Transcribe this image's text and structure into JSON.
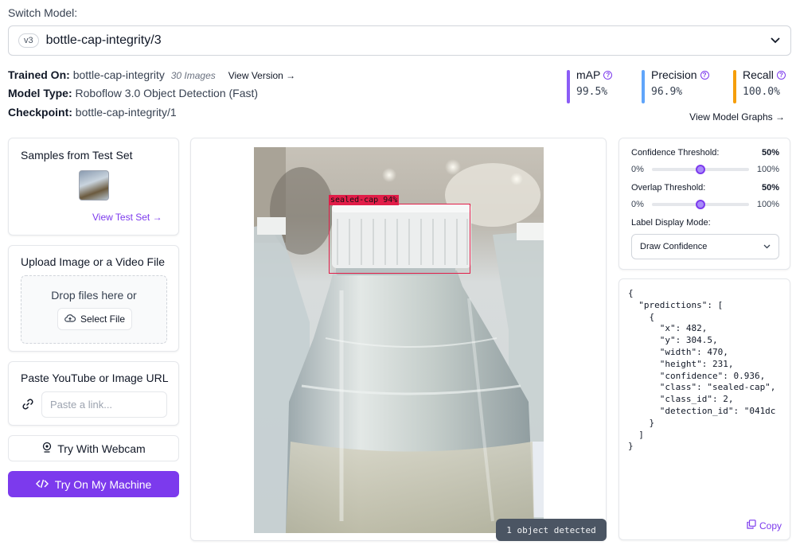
{
  "header": {
    "switch_label": "Switch Model:",
    "model_version_badge": "v3",
    "model_name": "bottle-cap-integrity/3",
    "chevron_icon": "chevron-down-icon"
  },
  "model_info": {
    "trained_on_label": "Trained On:",
    "trained_on_value": "bottle-cap-integrity",
    "image_count": "30 Images",
    "view_version": "View Version →",
    "model_type_label": "Model Type:",
    "model_type_value": "Roboflow 3.0 Object Detection (Fast)",
    "checkpoint_label": "Checkpoint:",
    "checkpoint_value": "bottle-cap-integrity/1"
  },
  "metrics": [
    {
      "label": "mAP",
      "value": "99.5%",
      "color": "#8b5cf6"
    },
    {
      "label": "Precision",
      "value": "96.9%",
      "color": "#60a5fa"
    },
    {
      "label": "Recall",
      "value": "100.0%",
      "color": "#f59e0b"
    }
  ],
  "view_model_graphs": "View Model Graphs →",
  "samples": {
    "title": "Samples from Test Set",
    "link": "View Test Set →"
  },
  "upload": {
    "title": "Upload Image or a Video File",
    "drop_text": "Drop files here or",
    "select_button": "Select File"
  },
  "url": {
    "title": "Paste YouTube or Image URL",
    "placeholder": "Paste a link..."
  },
  "webcam_button": "Try With Webcam",
  "machine_button": "Try On My Machine",
  "detection": {
    "label": "sealed-cap 94%",
    "status": "1 object detected"
  },
  "settings": {
    "confidence_label": "Confidence Threshold:",
    "confidence_value": "50%",
    "overlap_label": "Overlap Threshold:",
    "overlap_value": "50%",
    "min_label": "0%",
    "max_label": "100%",
    "confidence_level": 0.5,
    "overlap_level": 0.5,
    "display_mode_label": "Label Display Mode:",
    "display_mode_value": "Draw Confidence"
  },
  "json_output": {
    "lines": [
      "{",
      "  \"predictions\": [",
      "    {",
      "      \"x\": 482,",
      "      \"y\": 304.5,",
      "      \"width\": 470,",
      "      \"height\": 231,",
      "      \"confidence\": 0.936,",
      "      \"class\": \"sealed-cap\",",
      "      \"class_id\": 2,",
      "      \"detection_id\": \"041dc",
      "    }",
      "  ]",
      "}"
    ],
    "copy_label": "Copy"
  }
}
